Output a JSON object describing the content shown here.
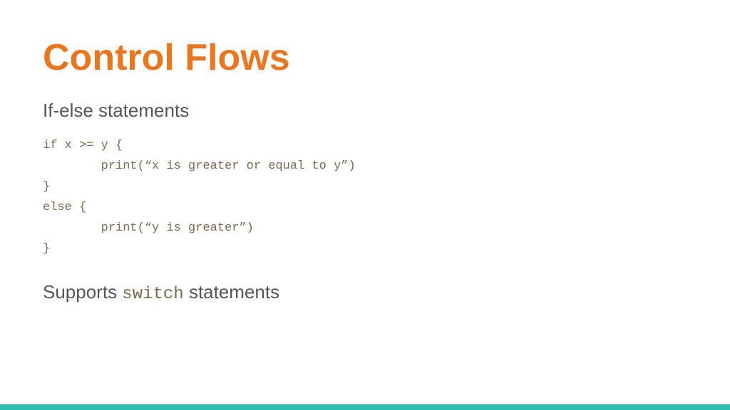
{
  "slide": {
    "title": "Control Flows",
    "section1": {
      "heading": "If-else statements",
      "code": {
        "line1": "if x >= y {",
        "line2": "        print(“x is greater or equal to y”)",
        "line3": "}",
        "line4": "else {",
        "line5": "        print(“y is greater”)",
        "line6": "}"
      }
    },
    "section2": {
      "text_before": "Supports ",
      "code_word": "switch",
      "text_after": " statements"
    }
  },
  "bottom_bar": {
    "color": "#2bbcb4"
  }
}
